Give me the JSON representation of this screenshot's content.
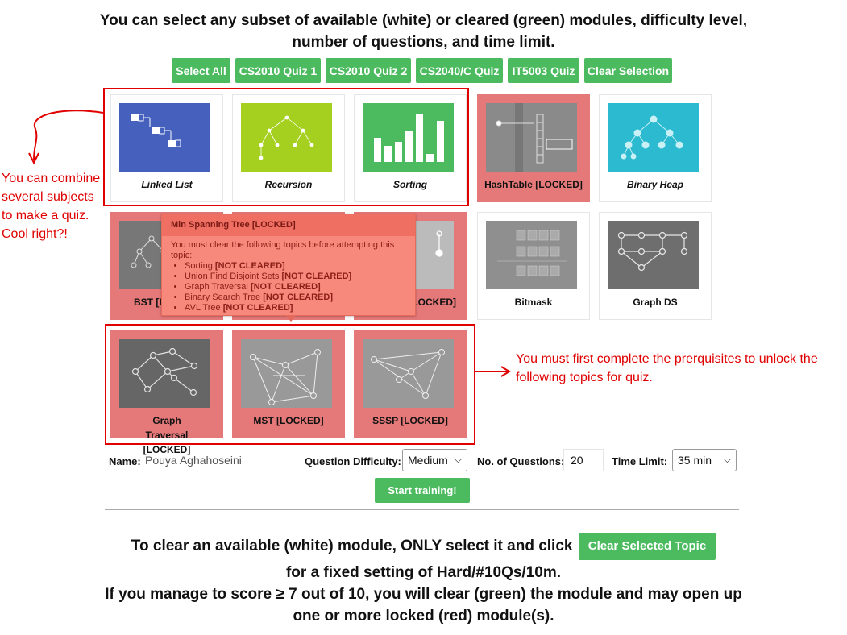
{
  "heading": {
    "line1": "You can select any subset of available (white) or cleared (green) modules, difficulty level,",
    "line2": "number of questions, and time limit."
  },
  "quick_buttons": [
    "Select All",
    "CS2010 Quiz 1",
    "CS2010 Quiz 2",
    "CS2040/C Quiz",
    "IT5003 Quiz",
    "Clear Selection"
  ],
  "modules": {
    "linked_list": "Linked List",
    "recursion": "Recursion",
    "sorting": "Sorting",
    "hashtable": "HashTable [LOCKED]",
    "binary_heap": "Binary Heap",
    "bst": "BST [L",
    "ufds": "[LOCKED]",
    "bitmask": "Bitmask",
    "graph_ds": "Graph DS",
    "graph_traversal": "Graph Traversal [LOCKED]",
    "mst": "MST [LOCKED]",
    "sssp": "SSSP [LOCKED]"
  },
  "annotations": {
    "left": "You can combine several subjects to make a quiz. Cool right?!",
    "right": "You must first complete the prerquisites to unlock the following topics for quiz."
  },
  "tooltip": {
    "title": "Min Spanning Tree [LOCKED]",
    "intro": "You must clear the following topics before attempting this topic:",
    "items": [
      {
        "name": "Sorting",
        "status": "[NOT CLEARED]"
      },
      {
        "name": "Union Find Disjoint Sets",
        "status": "[NOT CLEARED]"
      },
      {
        "name": "Graph Traversal",
        "status": "[NOT CLEARED]"
      },
      {
        "name": "Binary Search Tree",
        "status": "[NOT CLEARED]"
      },
      {
        "name": "AVL Tree",
        "status": "[NOT CLEARED]"
      }
    ]
  },
  "form": {
    "name_label": "Name:",
    "name_value": "Pouya Aghahoseini",
    "difficulty_label": "Question Difficulty:",
    "difficulty_value": "Medium",
    "questions_label": "No. of Questions:",
    "questions_value": "20",
    "time_label": "Time Limit:",
    "time_value": "35 min",
    "start_button": "Start training!"
  },
  "bottom": {
    "line1_pre": "To clear an available (white) module, ONLY select it and click",
    "clear_button": "Clear Selected Topic",
    "line2": "for a fixed setting of Hard/#10Qs/10m.",
    "line3": "If you manage to score ≥ 7 out of 10, you will clear (green) the module and may open up",
    "line4": "one or more locked (red) module(s)."
  },
  "colors": {
    "green": "#4cbb5f",
    "locked_red": "#e57878",
    "annotation_red": "#e00000",
    "tooltip_bg": "#f7887c"
  }
}
